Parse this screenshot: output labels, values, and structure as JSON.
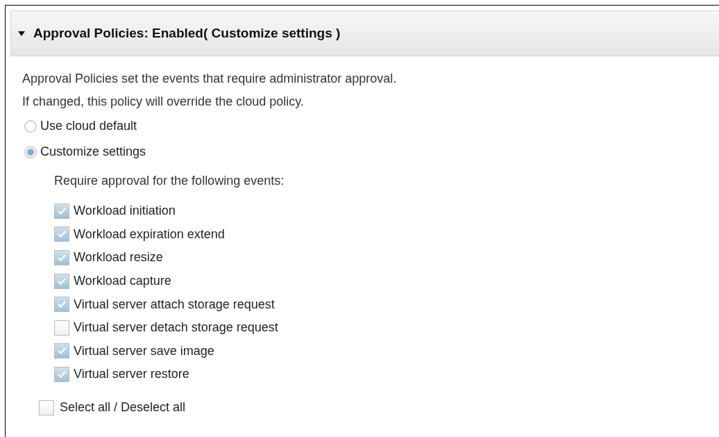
{
  "section": {
    "title": "Approval Policies: Enabled( Customize settings )",
    "expanded": true
  },
  "description": [
    "Approval Policies set the events that require administrator approval.",
    "If changed, this policy will override the cloud policy."
  ],
  "options": [
    {
      "label": "Use cloud default",
      "selected": false
    },
    {
      "label": "Customize settings",
      "selected": true
    }
  ],
  "events_heading": "Require approval for the following events:",
  "events": [
    {
      "label": "Workload initiation",
      "checked": true
    },
    {
      "label": "Workload expiration extend",
      "checked": true
    },
    {
      "label": "Workload resize",
      "checked": true
    },
    {
      "label": "Workload capture",
      "checked": true
    },
    {
      "label": "Virtual server attach storage request",
      "checked": true
    },
    {
      "label": "Virtual server detach storage request",
      "checked": false
    },
    {
      "label": "Virtual server save image",
      "checked": true
    },
    {
      "label": "Virtual server restore",
      "checked": true
    }
  ],
  "select_all": {
    "label": "Select all / Deselect all",
    "checked": false
  }
}
